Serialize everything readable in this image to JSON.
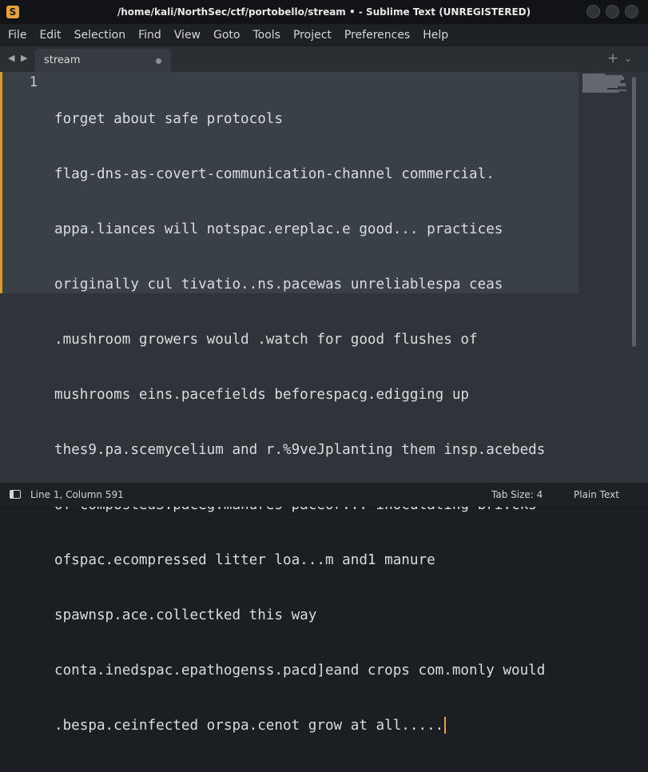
{
  "window": {
    "title": "/home/kali/NorthSec/ctf/portobello/stream • - Sublime Text (UNREGISTERED)",
    "app_icon": "S"
  },
  "menu": {
    "items": [
      "File",
      "Edit",
      "Selection",
      "Find",
      "View",
      "Goto",
      "Tools",
      "Project",
      "Preferences",
      "Help"
    ]
  },
  "tabs": {
    "active": {
      "label": "stream",
      "modified": true
    },
    "new_tab_label": "+",
    "dropdown_label": "⌄"
  },
  "editor": {
    "line_number": "1",
    "lines": [
      "forget about safe protocols",
      "flag-dns-as-covert-communication-channel commercial.",
      "appa.liances will notspac.ereplac.e good... practices",
      "originally cul tivatio..ns.pacewas unreliablespa ceas",
      ".mushroom growers would .watch for good flushes of",
      "mushrooms eins.pacefields beforespacg.edigging up",
      "thes9.pa.scemycelium and r.%9veJplanting them insp.acebeds",
      "of compostedS.paceg.manures paceor... inoculating bri.cks",
      "ofspac.ecompressed litter loa...m and1 manure",
      "spawnsp.ace.collectked this way",
      "conta.inedspac.epathogenss.pacd]eand crops com.monly would",
      ".bespa.ceinfected orspa.cenot grow at all....."
    ]
  },
  "status": {
    "position": "Line 1, Column 591",
    "tab_size": "Tab Size: 4",
    "syntax": "Plain Text"
  },
  "colors": {
    "accent": "#f0a030",
    "modified_marker": "#d79b3a",
    "editor_bg": "#2f343a",
    "selection_bg": "#3a4047"
  }
}
